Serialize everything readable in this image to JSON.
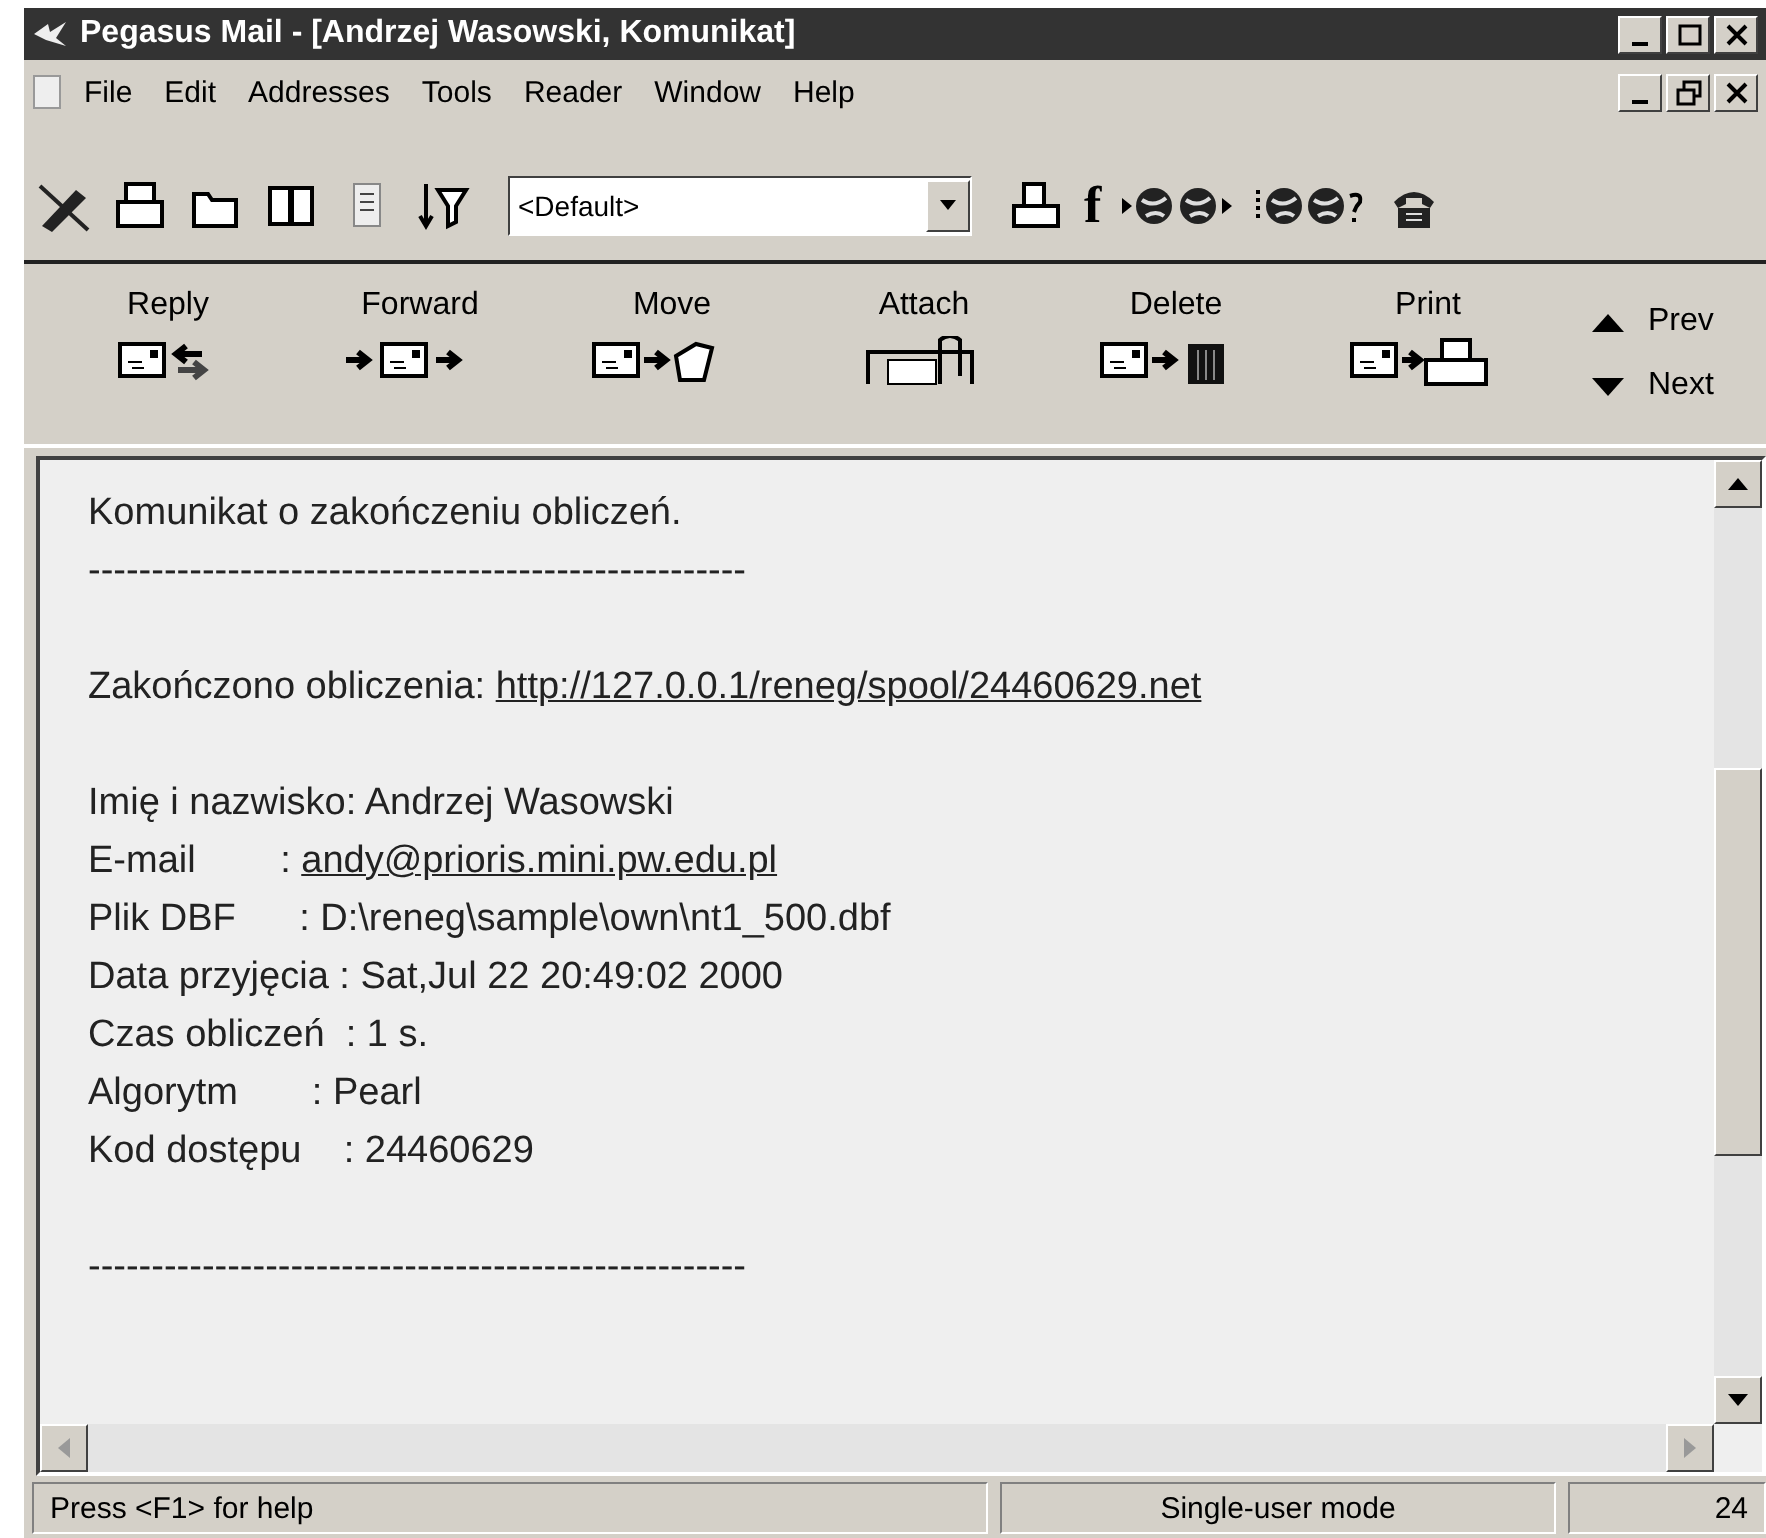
{
  "window": {
    "title": "Pegasus Mail - [Andrzej Wasowski, Komunikat]"
  },
  "menu": [
    "File",
    "Edit",
    "Addresses",
    "Tools",
    "Reader",
    "Window",
    "Help"
  ],
  "toolbar": {
    "combobox": "<Default>",
    "glyph": "f"
  },
  "buttons": [
    {
      "label": "Reply"
    },
    {
      "label": "Forward"
    },
    {
      "label": "Move"
    },
    {
      "label": "Attach"
    },
    {
      "label": "Delete"
    },
    {
      "label": "Print"
    }
  ],
  "nav": [
    {
      "label": "Prev",
      "kind": "up"
    },
    {
      "label": "Next",
      "kind": "down"
    }
  ],
  "message": [
    {
      "kind": "text",
      "text": "Komunikat o zakończeniu obliczeń."
    },
    {
      "kind": "rule",
      "text": "----------------------------------------------------"
    },
    {
      "kind": "blank"
    },
    {
      "kind": "text",
      "text": "Zakończono obliczenia: ",
      "link": "http://127.0.0.1/reneg/spool/24460629.net"
    },
    {
      "kind": "blank"
    },
    {
      "kind": "text",
      "text": "Imię i nazwisko: Andrzej Wasowski"
    },
    {
      "kind": "text",
      "text": "E-mail        : ",
      "link": "andy@prioris.mini.pw.edu.pl"
    },
    {
      "kind": "text",
      "text": "Plik DBF      : D:\\reneg\\sample\\own\\nt1_500.dbf"
    },
    {
      "kind": "text",
      "text": "Data przyjęcia : Sat,Jul 22 20:49:02 2000"
    },
    {
      "kind": "text",
      "text": "Czas obliczeń  : 1 s."
    },
    {
      "kind": "text",
      "text": "Algorytm       : Pearl"
    },
    {
      "kind": "text",
      "text": "Kod dostępu    : 24460629"
    },
    {
      "kind": "blank"
    },
    {
      "kind": "rule",
      "text": "----------------------------------------------------"
    }
  ],
  "status_bar": [
    "Press <F1> for help",
    "Single-user mode",
    "24"
  ]
}
